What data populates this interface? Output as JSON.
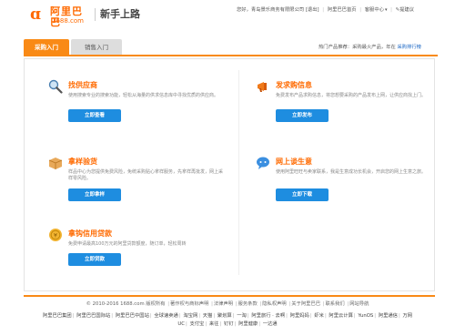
{
  "header": {
    "logo_glyph": "ɑ",
    "logo_cn": "阿里巴巴",
    "logo_url": "1688.com",
    "page_title": "新手上路",
    "greeting": "您好，青岛景乐商务有限限公司",
    "logout": "[退出]",
    "links": [
      "阿里巴巴首页",
      "客服中心",
      "提建议"
    ]
  },
  "tabs": {
    "items": [
      {
        "label": "采购入门"
      },
      {
        "label": "销售入门"
      }
    ],
    "right_prefix": "热门产品推荐：采购最火产品，年在",
    "right_link": "采购排行榜"
  },
  "cards": [
    {
      "icon": "search-icon",
      "title": "找供应商",
      "desc": "使用搜索专业的搜索功能，轻松从海量的供求信息库中寻找优质的供应商。",
      "button": "立即查看"
    },
    {
      "icon": "megaphone-icon",
      "title": "发求购信息",
      "desc": "免费发布产品求购信息，将您想要采购的产品发布上网，让供应商找上门。",
      "button": "立即发布"
    },
    {
      "icon": "box-icon",
      "title": "拿样验货",
      "desc": "样品中心为您提供免费风险，免统采购贴心拿样服务，先拿样再批发，网上采样零风险。",
      "button": "立即拿样"
    },
    {
      "icon": "chat-icon",
      "title": "网上谈生意",
      "desc": "使用阿里旺旺与卖家联系，我是生意成功长机会，开启您的网上生意之旅。",
      "button": "立即下载"
    },
    {
      "icon": "coin-icon",
      "title": "拿钩信用贷款",
      "desc": "免费申请最高100万元的阿里贷款额度，随订单，轻松周转",
      "button": "立即贷款"
    }
  ],
  "footer": {
    "copy": [
      "© 2010-2016 1688.com 版权所有",
      "著作权与商标声明",
      "法律声明",
      "服务条款",
      "隐私权声明",
      "关于阿里巴巴",
      "联系我们",
      "网站导航"
    ],
    "links": [
      "阿里巴巴集团",
      "阿里巴巴国际站",
      "阿里巴巴中国站",
      "全球速卖通",
      "淘宝网",
      "天猫",
      "聚划算",
      "一淘",
      "阿里旅行 · 去啊",
      "阿里妈妈",
      "虾米",
      "阿里云计算",
      "YunOS",
      "阿里通信",
      "万网",
      "UC",
      "支付宝",
      "来往",
      "钉钉",
      "阿里健康",
      "一达通"
    ]
  },
  "colors": {
    "accent": "#ff6a00",
    "tab_active": "#f98a16",
    "button": "#1e8de0",
    "link": "#1a66c4"
  }
}
